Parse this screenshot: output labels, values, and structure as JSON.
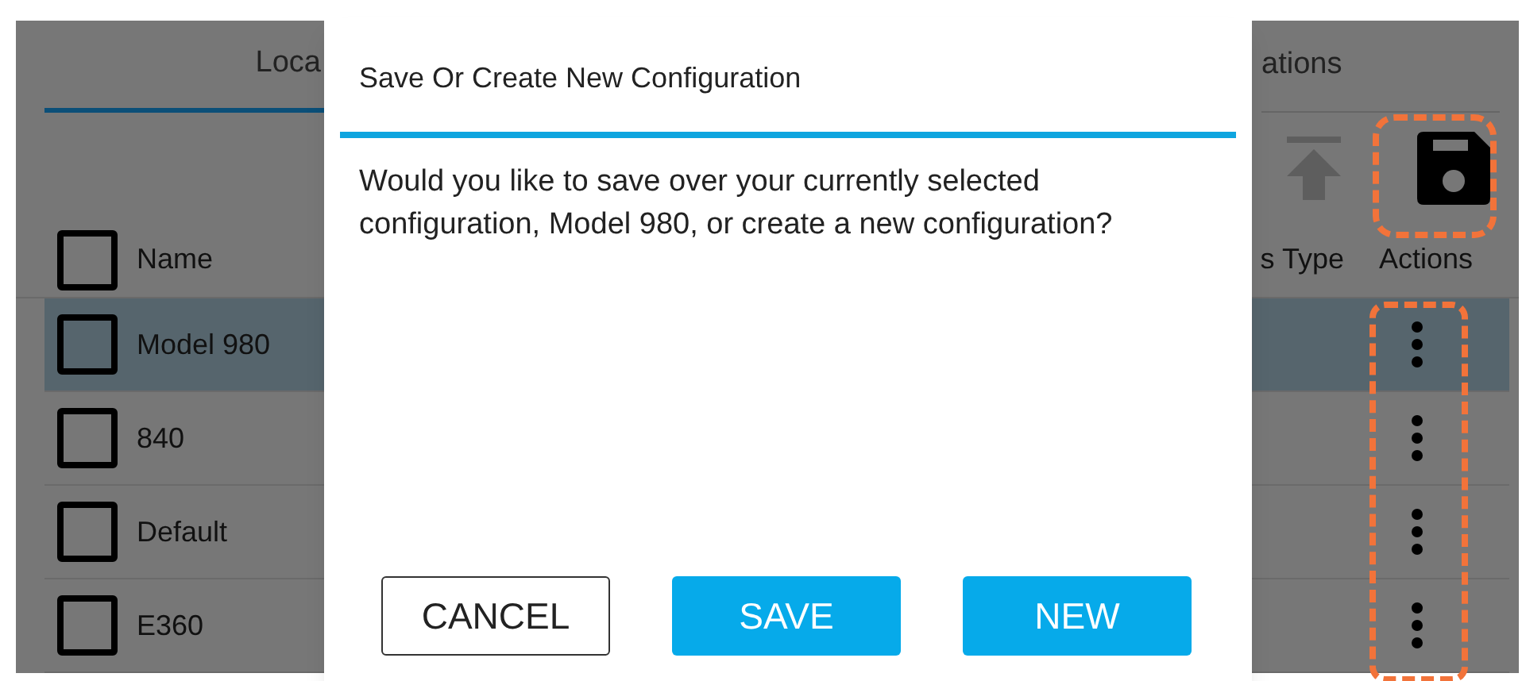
{
  "tabs": [
    {
      "label": "Loca",
      "selected": true
    },
    {
      "label": "ations",
      "selected": false
    }
  ],
  "toolbar": {
    "upload_disabled": true
  },
  "table": {
    "columns": [
      "Name",
      "s Type",
      "Actions"
    ],
    "header_checked": false,
    "rows": [
      {
        "name": "Model 980",
        "selected": true,
        "checked": false
      },
      {
        "name": "840",
        "selected": false,
        "checked": false
      },
      {
        "name": "Default",
        "selected": false,
        "checked": false
      },
      {
        "name": "E360",
        "selected": false,
        "checked": false
      }
    ]
  },
  "dialog": {
    "title": "Save Or Create New Configuration",
    "message": "Would you like to save over your currently selected configuration, Model 980, or create a new configuration?",
    "buttons": [
      {
        "label": "CANCEL",
        "kind": "outline"
      },
      {
        "label": "SAVE",
        "kind": "filled"
      },
      {
        "label": "NEW",
        "kind": "filled"
      }
    ]
  }
}
